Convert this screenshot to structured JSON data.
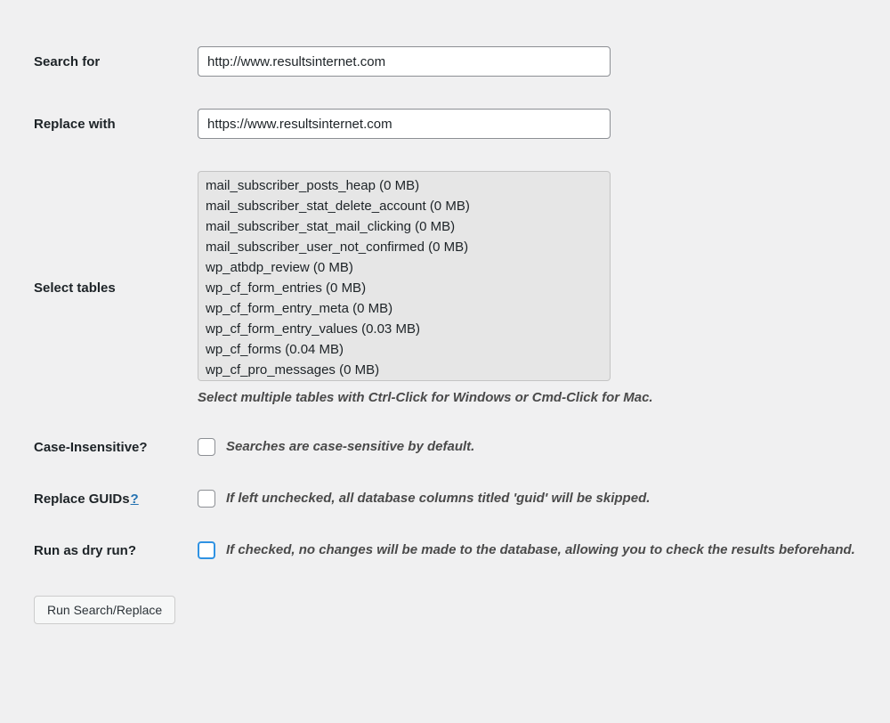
{
  "labels": {
    "search_for": "Search for",
    "replace_with": "Replace with",
    "select_tables": "Select tables",
    "case_insensitive": "Case-Insensitive?",
    "replace_guids": "Replace GUIDs",
    "help_q": "?",
    "dry_run": "Run as dry run?"
  },
  "inputs": {
    "search_for": "http://www.resultsinternet.com",
    "replace_with": "https://www.resultsinternet.com"
  },
  "tables": [
    "mail_subscriber_posts_heap (0 MB)",
    "mail_subscriber_stat_delete_account (0 MB)",
    "mail_subscriber_stat_mail_clicking (0 MB)",
    "mail_subscriber_user_not_confirmed (0 MB)",
    "wp_atbdp_review (0 MB)",
    "wp_cf_form_entries (0 MB)",
    "wp_cf_form_entry_meta (0 MB)",
    "wp_cf_form_entry_values (0.03 MB)",
    "wp_cf_forms (0.04 MB)",
    "wp_cf_pro_messages (0 MB)"
  ],
  "hints": {
    "tables": "Select multiple tables with Ctrl-Click for Windows or Cmd-Click for Mac.",
    "case": "Searches are case-sensitive by default.",
    "guids": "If left unchecked, all database columns titled 'guid' will be skipped.",
    "dry": "If checked, no changes will be made to the database, allowing you to check the results beforehand."
  },
  "buttons": {
    "submit": "Run Search/Replace"
  }
}
